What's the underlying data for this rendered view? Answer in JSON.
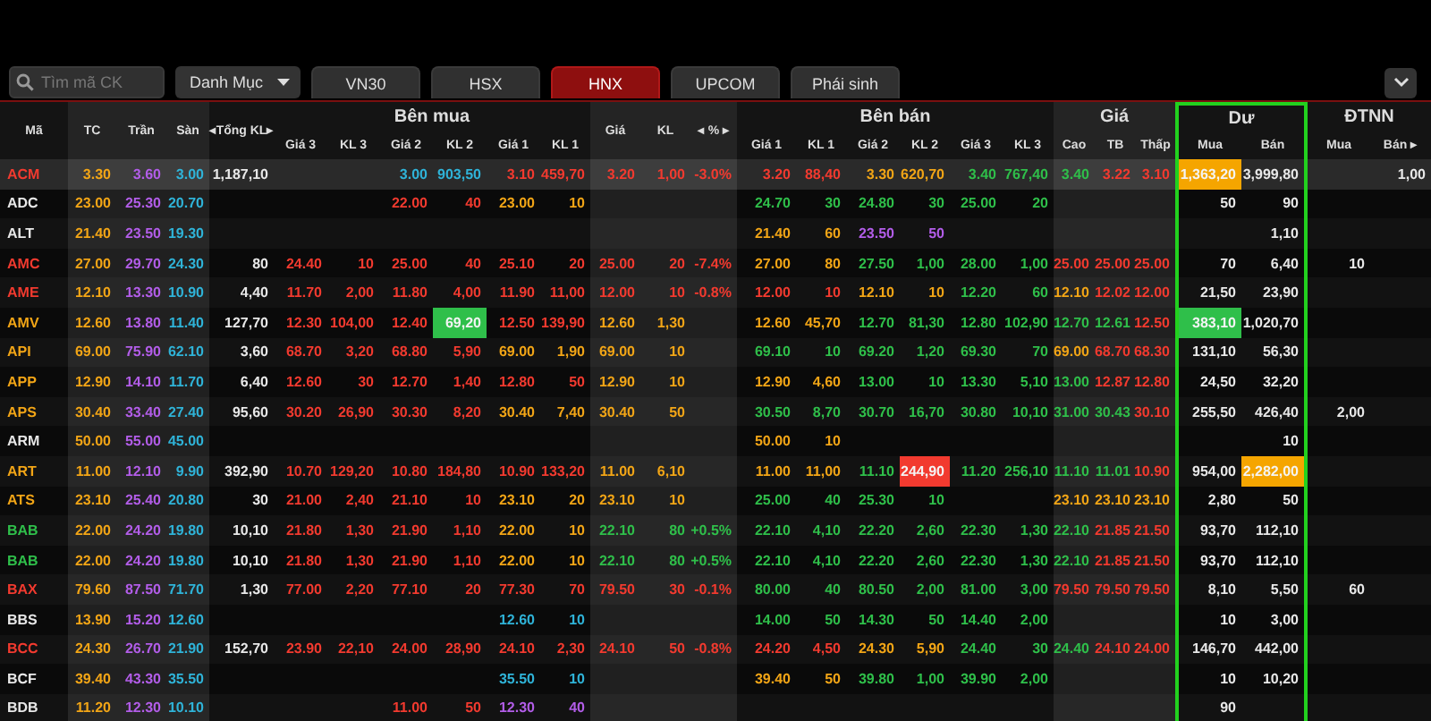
{
  "toolbar": {
    "search": {
      "placeholder": "Tìm mã CK"
    },
    "category_dropdown": {
      "label": "Danh Mục"
    },
    "tabs": [
      {
        "label": "VN30",
        "selected": false
      },
      {
        "label": "HSX",
        "selected": false
      },
      {
        "label": "HNX",
        "selected": true
      },
      {
        "label": "UPCOM",
        "selected": false
      },
      {
        "label": "Phái sinh",
        "selected": false
      }
    ]
  },
  "table": {
    "column_groups": [
      {
        "columns": [
          "Mã"
        ],
        "highlighted": false
      },
      {
        "columns": [
          "TC",
          "Trần",
          "Sàn"
        ],
        "highlighted": false
      },
      {
        "columns": [
          "◂Tổng KL▸"
        ],
        "highlighted": false
      },
      {
        "label": "Bên mua",
        "columns": [
          "Giá 3",
          "KL 3",
          "Giá 2",
          "KL 2",
          "Giá 1",
          "KL 1"
        ],
        "highlighted": false
      },
      {
        "columns": [
          "Giá",
          "KL",
          "◂ % ▸"
        ],
        "highlighted": false
      },
      {
        "label": "Bên bán",
        "columns": [
          "Giá 1",
          "KL 1",
          "Giá 2",
          "KL 2",
          "Giá 3",
          "KL 3"
        ],
        "highlighted": false
      },
      {
        "label": "Giá",
        "columns": [
          "Cao",
          "TB",
          "Thấp"
        ],
        "highlighted": false
      },
      {
        "label": "Dư",
        "columns": [
          "Mua",
          "Bán"
        ],
        "highlighted": true
      },
      {
        "label": "ĐTNN",
        "columns": [
          "Mua",
          "Bán ▸"
        ],
        "highlighted": false
      }
    ],
    "rows": [
      {
        "selected": true,
        "cells": [
          {
            "text": "ACM",
            "color": "#f23a2f"
          },
          {
            "text": "3.30",
            "color": "#f2a516"
          },
          {
            "text": "3.60",
            "color": "#b25de8"
          },
          {
            "text": "3.00",
            "color": "#2fb3d8"
          },
          {
            "text": "1,187,10",
            "color": "#e8e8e8"
          },
          null,
          null,
          {
            "text": "3.00",
            "color": "#2fb3d8"
          },
          {
            "text": "903,50",
            "color": "#2fb3d8"
          },
          {
            "text": "3.10",
            "color": "#f23a2f"
          },
          {
            "text": "459,70",
            "color": "#f23a2f"
          },
          {
            "text": "3.20",
            "color": "#f23a2f"
          },
          {
            "text": "1,00",
            "color": "#f23a2f"
          },
          {
            "text": "-3.0%",
            "color": "#f23a2f"
          },
          {
            "text": "3.20",
            "color": "#f23a2f"
          },
          {
            "text": "88,40",
            "color": "#f23a2f"
          },
          {
            "text": "3.30",
            "color": "#f2a516"
          },
          {
            "text": "620,70",
            "color": "#f2a516"
          },
          {
            "text": "3.40",
            "color": "#2fbf4a"
          },
          {
            "text": "767,40",
            "color": "#2fbf4a"
          },
          {
            "text": "3.40",
            "color": "#2fbf4a"
          },
          {
            "text": "3.22",
            "color": "#f23a2f"
          },
          {
            "text": "3.10",
            "color": "#f23a2f"
          },
          {
            "text": "1,363,20",
            "color": "#f5a500",
            "highlighted": true
          },
          {
            "text": "3,999,80",
            "color": "#e8e8e8"
          },
          null,
          {
            "text": "1,00",
            "color": "#e8e8e8"
          }
        ]
      },
      {
        "selected": false,
        "cells": [
          {
            "text": "ADC",
            "color": "#e8e8e8"
          },
          {
            "text": "23.00",
            "color": "#f2a516"
          },
          {
            "text": "25.30",
            "color": "#b25de8"
          },
          {
            "text": "20.70",
            "color": "#2fb3d8"
          },
          null,
          null,
          null,
          {
            "text": "22.00",
            "color": "#f23a2f"
          },
          {
            "text": "40",
            "color": "#f23a2f"
          },
          {
            "text": "23.00",
            "color": "#f2a516"
          },
          {
            "text": "10",
            "color": "#f2a516"
          },
          null,
          null,
          null,
          {
            "text": "24.70",
            "color": "#2fbf4a"
          },
          {
            "text": "30",
            "color": "#2fbf4a"
          },
          {
            "text": "24.80",
            "color": "#2fbf4a"
          },
          {
            "text": "30",
            "color": "#2fbf4a"
          },
          {
            "text": "25.00",
            "color": "#2fbf4a"
          },
          {
            "text": "20",
            "color": "#2fbf4a"
          },
          null,
          null,
          null,
          {
            "text": "50",
            "color": "#e8e8e8"
          },
          {
            "text": "90",
            "color": "#e8e8e8"
          },
          null,
          null
        ]
      },
      {
        "selected": false,
        "cells": [
          {
            "text": "ALT",
            "color": "#e8e8e8"
          },
          {
            "text": "21.40",
            "color": "#f2a516"
          },
          {
            "text": "23.50",
            "color": "#b25de8"
          },
          {
            "text": "19.30",
            "color": "#2fb3d8"
          },
          null,
          null,
          null,
          null,
          null,
          null,
          null,
          null,
          null,
          null,
          {
            "text": "21.40",
            "color": "#f2a516"
          },
          {
            "text": "60",
            "color": "#f2a516"
          },
          {
            "text": "23.50",
            "color": "#b25de8"
          },
          {
            "text": "50",
            "color": "#b25de8"
          },
          null,
          null,
          null,
          null,
          null,
          null,
          {
            "text": "1,10",
            "color": "#e8e8e8"
          },
          null,
          null
        ]
      },
      {
        "selected": false,
        "cells": [
          {
            "text": "AMC",
            "color": "#f23a2f"
          },
          {
            "text": "27.00",
            "color": "#f2a516"
          },
          {
            "text": "29.70",
            "color": "#b25de8"
          },
          {
            "text": "24.30",
            "color": "#2fb3d8"
          },
          {
            "text": "80",
            "color": "#e8e8e8"
          },
          {
            "text": "24.40",
            "color": "#f23a2f"
          },
          {
            "text": "10",
            "color": "#f23a2f"
          },
          {
            "text": "25.00",
            "color": "#f23a2f"
          },
          {
            "text": "40",
            "color": "#f23a2f"
          },
          {
            "text": "25.10",
            "color": "#f23a2f"
          },
          {
            "text": "20",
            "color": "#f23a2f"
          },
          {
            "text": "25.00",
            "color": "#f23a2f"
          },
          {
            "text": "20",
            "color": "#f23a2f"
          },
          {
            "text": "-7.4%",
            "color": "#f23a2f"
          },
          {
            "text": "27.00",
            "color": "#f2a516"
          },
          {
            "text": "80",
            "color": "#f2a516"
          },
          {
            "text": "27.50",
            "color": "#2fbf4a"
          },
          {
            "text": "1,00",
            "color": "#2fbf4a"
          },
          {
            "text": "28.00",
            "color": "#2fbf4a"
          },
          {
            "text": "1,00",
            "color": "#2fbf4a"
          },
          {
            "text": "25.00",
            "color": "#f23a2f"
          },
          {
            "text": "25.00",
            "color": "#f23a2f"
          },
          {
            "text": "25.00",
            "color": "#f23a2f"
          },
          {
            "text": "70",
            "color": "#e8e8e8"
          },
          {
            "text": "6,40",
            "color": "#e8e8e8"
          },
          {
            "text": "10",
            "color": "#e8e8e8"
          },
          null
        ]
      },
      {
        "selected": false,
        "cells": [
          {
            "text": "AME",
            "color": "#f23a2f"
          },
          {
            "text": "12.10",
            "color": "#f2a516"
          },
          {
            "text": "13.30",
            "color": "#b25de8"
          },
          {
            "text": "10.90",
            "color": "#2fb3d8"
          },
          {
            "text": "4,40",
            "color": "#e8e8e8"
          },
          {
            "text": "11.70",
            "color": "#f23a2f"
          },
          {
            "text": "2,00",
            "color": "#f23a2f"
          },
          {
            "text": "11.80",
            "color": "#f23a2f"
          },
          {
            "text": "4,00",
            "color": "#f23a2f"
          },
          {
            "text": "11.90",
            "color": "#f23a2f"
          },
          {
            "text": "11,00",
            "color": "#f23a2f"
          },
          {
            "text": "12.00",
            "color": "#f23a2f"
          },
          {
            "text": "10",
            "color": "#f23a2f"
          },
          {
            "text": "-0.8%",
            "color": "#f23a2f"
          },
          {
            "text": "12.00",
            "color": "#f23a2f"
          },
          {
            "text": "10",
            "color": "#f23a2f"
          },
          {
            "text": "12.10",
            "color": "#f2a516"
          },
          {
            "text": "10",
            "color": "#f2a516"
          },
          {
            "text": "12.20",
            "color": "#2fbf4a"
          },
          {
            "text": "60",
            "color": "#2fbf4a"
          },
          {
            "text": "12.10",
            "color": "#f2a516"
          },
          {
            "text": "12.02",
            "color": "#f23a2f"
          },
          {
            "text": "12.00",
            "color": "#f23a2f"
          },
          {
            "text": "21,50",
            "color": "#e8e8e8"
          },
          {
            "text": "23,90",
            "color": "#e8e8e8"
          },
          null,
          null
        ]
      },
      {
        "selected": false,
        "cells": [
          {
            "text": "AMV",
            "color": "#f2a516"
          },
          {
            "text": "12.60",
            "color": "#f2a516"
          },
          {
            "text": "13.80",
            "color": "#b25de8"
          },
          {
            "text": "11.40",
            "color": "#2fb3d8"
          },
          {
            "text": "127,70",
            "color": "#e8e8e8"
          },
          {
            "text": "12.30",
            "color": "#f23a2f"
          },
          {
            "text": "104,00",
            "color": "#f23a2f"
          },
          {
            "text": "12.40",
            "color": "#f23a2f"
          },
          {
            "text": "69,20",
            "color": "#2fbf4a",
            "highlighted": true
          },
          {
            "text": "12.50",
            "color": "#f23a2f"
          },
          {
            "text": "139,90",
            "color": "#f23a2f"
          },
          {
            "text": "12.60",
            "color": "#f2a516"
          },
          {
            "text": "1,30",
            "color": "#f2a516"
          },
          null,
          {
            "text": "12.60",
            "color": "#f2a516"
          },
          {
            "text": "45,70",
            "color": "#f2a516"
          },
          {
            "text": "12.70",
            "color": "#2fbf4a"
          },
          {
            "text": "81,30",
            "color": "#2fbf4a"
          },
          {
            "text": "12.80",
            "color": "#2fbf4a"
          },
          {
            "text": "102,90",
            "color": "#2fbf4a"
          },
          {
            "text": "12.70",
            "color": "#2fbf4a"
          },
          {
            "text": "12.61",
            "color": "#2fbf4a"
          },
          {
            "text": "12.50",
            "color": "#f23a2f"
          },
          {
            "text": "383,10",
            "color": "#2fbf4a",
            "highlighted": true
          },
          {
            "text": "1,020,70",
            "color": "#e8e8e8"
          },
          null,
          null
        ]
      },
      {
        "selected": false,
        "cells": [
          {
            "text": "API",
            "color": "#f2a516"
          },
          {
            "text": "69.00",
            "color": "#f2a516"
          },
          {
            "text": "75.90",
            "color": "#b25de8"
          },
          {
            "text": "62.10",
            "color": "#2fb3d8"
          },
          {
            "text": "3,60",
            "color": "#e8e8e8"
          },
          {
            "text": "68.70",
            "color": "#f23a2f"
          },
          {
            "text": "3,20",
            "color": "#f23a2f"
          },
          {
            "text": "68.80",
            "color": "#f23a2f"
          },
          {
            "text": "5,90",
            "color": "#f23a2f"
          },
          {
            "text": "69.00",
            "color": "#f2a516"
          },
          {
            "text": "1,90",
            "color": "#f2a516"
          },
          {
            "text": "69.00",
            "color": "#f2a516"
          },
          {
            "text": "10",
            "color": "#f2a516"
          },
          null,
          {
            "text": "69.10",
            "color": "#2fbf4a"
          },
          {
            "text": "10",
            "color": "#2fbf4a"
          },
          {
            "text": "69.20",
            "color": "#2fbf4a"
          },
          {
            "text": "1,20",
            "color": "#2fbf4a"
          },
          {
            "text": "69.30",
            "color": "#2fbf4a"
          },
          {
            "text": "70",
            "color": "#2fbf4a"
          },
          {
            "text": "69.00",
            "color": "#f2a516"
          },
          {
            "text": "68.70",
            "color": "#f23a2f"
          },
          {
            "text": "68.30",
            "color": "#f23a2f"
          },
          {
            "text": "131,10",
            "color": "#e8e8e8"
          },
          {
            "text": "56,30",
            "color": "#e8e8e8"
          },
          null,
          null
        ]
      },
      {
        "selected": false,
        "cells": [
          {
            "text": "APP",
            "color": "#f2a516"
          },
          {
            "text": "12.90",
            "color": "#f2a516"
          },
          {
            "text": "14.10",
            "color": "#b25de8"
          },
          {
            "text": "11.70",
            "color": "#2fb3d8"
          },
          {
            "text": "6,40",
            "color": "#e8e8e8"
          },
          {
            "text": "12.60",
            "color": "#f23a2f"
          },
          {
            "text": "30",
            "color": "#f23a2f"
          },
          {
            "text": "12.70",
            "color": "#f23a2f"
          },
          {
            "text": "1,40",
            "color": "#f23a2f"
          },
          {
            "text": "12.80",
            "color": "#f23a2f"
          },
          {
            "text": "50",
            "color": "#f23a2f"
          },
          {
            "text": "12.90",
            "color": "#f2a516"
          },
          {
            "text": "10",
            "color": "#f2a516"
          },
          null,
          {
            "text": "12.90",
            "color": "#f2a516"
          },
          {
            "text": "4,60",
            "color": "#f2a516"
          },
          {
            "text": "13.00",
            "color": "#2fbf4a"
          },
          {
            "text": "10",
            "color": "#2fbf4a"
          },
          {
            "text": "13.30",
            "color": "#2fbf4a"
          },
          {
            "text": "5,10",
            "color": "#2fbf4a"
          },
          {
            "text": "13.00",
            "color": "#2fbf4a"
          },
          {
            "text": "12.87",
            "color": "#f23a2f"
          },
          {
            "text": "12.80",
            "color": "#f23a2f"
          },
          {
            "text": "24,50",
            "color": "#e8e8e8"
          },
          {
            "text": "32,20",
            "color": "#e8e8e8"
          },
          null,
          null
        ]
      },
      {
        "selected": false,
        "cells": [
          {
            "text": "APS",
            "color": "#f2a516"
          },
          {
            "text": "30.40",
            "color": "#f2a516"
          },
          {
            "text": "33.40",
            "color": "#b25de8"
          },
          {
            "text": "27.40",
            "color": "#2fb3d8"
          },
          {
            "text": "95,60",
            "color": "#e8e8e8"
          },
          {
            "text": "30.20",
            "color": "#f23a2f"
          },
          {
            "text": "26,90",
            "color": "#f23a2f"
          },
          {
            "text": "30.30",
            "color": "#f23a2f"
          },
          {
            "text": "8,20",
            "color": "#f23a2f"
          },
          {
            "text": "30.40",
            "color": "#f2a516"
          },
          {
            "text": "7,40",
            "color": "#f2a516"
          },
          {
            "text": "30.40",
            "color": "#f2a516"
          },
          {
            "text": "50",
            "color": "#f2a516"
          },
          null,
          {
            "text": "30.50",
            "color": "#2fbf4a"
          },
          {
            "text": "8,70",
            "color": "#2fbf4a"
          },
          {
            "text": "30.70",
            "color": "#2fbf4a"
          },
          {
            "text": "16,70",
            "color": "#2fbf4a"
          },
          {
            "text": "30.80",
            "color": "#2fbf4a"
          },
          {
            "text": "10,10",
            "color": "#2fbf4a"
          },
          {
            "text": "31.00",
            "color": "#2fbf4a"
          },
          {
            "text": "30.43",
            "color": "#2fbf4a"
          },
          {
            "text": "30.10",
            "color": "#f23a2f"
          },
          {
            "text": "255,50",
            "color": "#e8e8e8"
          },
          {
            "text": "426,40",
            "color": "#e8e8e8"
          },
          {
            "text": "2,00",
            "color": "#e8e8e8"
          },
          null
        ]
      },
      {
        "selected": false,
        "cells": [
          {
            "text": "ARM",
            "color": "#e8e8e8"
          },
          {
            "text": "50.00",
            "color": "#f2a516"
          },
          {
            "text": "55.00",
            "color": "#b25de8"
          },
          {
            "text": "45.00",
            "color": "#2fb3d8"
          },
          null,
          null,
          null,
          null,
          null,
          null,
          null,
          null,
          null,
          null,
          {
            "text": "50.00",
            "color": "#f2a516"
          },
          {
            "text": "10",
            "color": "#f2a516"
          },
          null,
          null,
          null,
          null,
          null,
          null,
          null,
          null,
          {
            "text": "10",
            "color": "#e8e8e8"
          },
          null,
          null
        ]
      },
      {
        "selected": false,
        "cells": [
          {
            "text": "ART",
            "color": "#f2a516"
          },
          {
            "text": "11.00",
            "color": "#f2a516"
          },
          {
            "text": "12.10",
            "color": "#b25de8"
          },
          {
            "text": "9.90",
            "color": "#2fb3d8"
          },
          {
            "text": "392,90",
            "color": "#e8e8e8"
          },
          {
            "text": "10.70",
            "color": "#f23a2f"
          },
          {
            "text": "129,20",
            "color": "#f23a2f"
          },
          {
            "text": "10.80",
            "color": "#f23a2f"
          },
          {
            "text": "184,80",
            "color": "#f23a2f"
          },
          {
            "text": "10.90",
            "color": "#f23a2f"
          },
          {
            "text": "133,20",
            "color": "#f23a2f"
          },
          {
            "text": "11.00",
            "color": "#f2a516"
          },
          {
            "text": "6,10",
            "color": "#f2a516"
          },
          null,
          {
            "text": "11.00",
            "color": "#f2a516"
          },
          {
            "text": "11,00",
            "color": "#f2a516"
          },
          {
            "text": "11.10",
            "color": "#2fbf4a"
          },
          {
            "text": "244,90",
            "color": "#f23a2f",
            "highlighted": true
          },
          {
            "text": "11.20",
            "color": "#2fbf4a"
          },
          {
            "text": "256,10",
            "color": "#2fbf4a"
          },
          {
            "text": "11.10",
            "color": "#2fbf4a"
          },
          {
            "text": "11.01",
            "color": "#2fbf4a"
          },
          {
            "text": "10.90",
            "color": "#f23a2f"
          },
          {
            "text": "954,00",
            "color": "#e8e8e8"
          },
          {
            "text": "2,282,00",
            "color": "#f5a500",
            "highlighted": true
          },
          null,
          null
        ]
      },
      {
        "selected": false,
        "cells": [
          {
            "text": "ATS",
            "color": "#f2a516"
          },
          {
            "text": "23.10",
            "color": "#f2a516"
          },
          {
            "text": "25.40",
            "color": "#b25de8"
          },
          {
            "text": "20.80",
            "color": "#2fb3d8"
          },
          {
            "text": "30",
            "color": "#e8e8e8"
          },
          {
            "text": "21.00",
            "color": "#f23a2f"
          },
          {
            "text": "2,40",
            "color": "#f23a2f"
          },
          {
            "text": "21.10",
            "color": "#f23a2f"
          },
          {
            "text": "10",
            "color": "#f23a2f"
          },
          {
            "text": "23.10",
            "color": "#f2a516"
          },
          {
            "text": "20",
            "color": "#f2a516"
          },
          {
            "text": "23.10",
            "color": "#f2a516"
          },
          {
            "text": "10",
            "color": "#f2a516"
          },
          null,
          {
            "text": "25.00",
            "color": "#2fbf4a"
          },
          {
            "text": "40",
            "color": "#2fbf4a"
          },
          {
            "text": "25.30",
            "color": "#2fbf4a"
          },
          {
            "text": "10",
            "color": "#2fbf4a"
          },
          null,
          null,
          {
            "text": "23.10",
            "color": "#f2a516"
          },
          {
            "text": "23.10",
            "color": "#f2a516"
          },
          {
            "text": "23.10",
            "color": "#f2a516"
          },
          {
            "text": "2,80",
            "color": "#e8e8e8"
          },
          {
            "text": "50",
            "color": "#e8e8e8"
          },
          null,
          null
        ]
      },
      {
        "selected": false,
        "cells": [
          {
            "text": "BAB",
            "color": "#2fbf4a"
          },
          {
            "text": "22.00",
            "color": "#f2a516"
          },
          {
            "text": "24.20",
            "color": "#b25de8"
          },
          {
            "text": "19.80",
            "color": "#2fb3d8"
          },
          {
            "text": "10,10",
            "color": "#e8e8e8"
          },
          {
            "text": "21.80",
            "color": "#f23a2f"
          },
          {
            "text": "1,30",
            "color": "#f23a2f"
          },
          {
            "text": "21.90",
            "color": "#f23a2f"
          },
          {
            "text": "1,10",
            "color": "#f23a2f"
          },
          {
            "text": "22.00",
            "color": "#f2a516"
          },
          {
            "text": "10",
            "color": "#f2a516"
          },
          {
            "text": "22.10",
            "color": "#2fbf4a"
          },
          {
            "text": "80",
            "color": "#2fbf4a"
          },
          {
            "text": "+0.5%",
            "color": "#2fbf4a"
          },
          {
            "text": "22.10",
            "color": "#2fbf4a"
          },
          {
            "text": "4,10",
            "color": "#2fbf4a"
          },
          {
            "text": "22.20",
            "color": "#2fbf4a"
          },
          {
            "text": "2,60",
            "color": "#2fbf4a"
          },
          {
            "text": "22.30",
            "color": "#2fbf4a"
          },
          {
            "text": "1,30",
            "color": "#2fbf4a"
          },
          {
            "text": "22.10",
            "color": "#2fbf4a"
          },
          {
            "text": "21.85",
            "color": "#f23a2f"
          },
          {
            "text": "21.50",
            "color": "#f23a2f"
          },
          {
            "text": "93,70",
            "color": "#e8e8e8"
          },
          {
            "text": "112,10",
            "color": "#e8e8e8"
          },
          null,
          null
        ]
      },
      {
        "selected": false,
        "cells": [
          {
            "text": "BAB",
            "color": "#2fbf4a"
          },
          {
            "text": "22.00",
            "color": "#f2a516"
          },
          {
            "text": "24.20",
            "color": "#b25de8"
          },
          {
            "text": "19.80",
            "color": "#2fb3d8"
          },
          {
            "text": "10,10",
            "color": "#e8e8e8"
          },
          {
            "text": "21.80",
            "color": "#f23a2f"
          },
          {
            "text": "1,30",
            "color": "#f23a2f"
          },
          {
            "text": "21.90",
            "color": "#f23a2f"
          },
          {
            "text": "1,10",
            "color": "#f23a2f"
          },
          {
            "text": "22.00",
            "color": "#f2a516"
          },
          {
            "text": "10",
            "color": "#f2a516"
          },
          {
            "text": "22.10",
            "color": "#2fbf4a"
          },
          {
            "text": "80",
            "color": "#2fbf4a"
          },
          {
            "text": "+0.5%",
            "color": "#2fbf4a"
          },
          {
            "text": "22.10",
            "color": "#2fbf4a"
          },
          {
            "text": "4,10",
            "color": "#2fbf4a"
          },
          {
            "text": "22.20",
            "color": "#2fbf4a"
          },
          {
            "text": "2,60",
            "color": "#2fbf4a"
          },
          {
            "text": "22.30",
            "color": "#2fbf4a"
          },
          {
            "text": "1,30",
            "color": "#2fbf4a"
          },
          {
            "text": "22.10",
            "color": "#2fbf4a"
          },
          {
            "text": "21.85",
            "color": "#f23a2f"
          },
          {
            "text": "21.50",
            "color": "#f23a2f"
          },
          {
            "text": "93,70",
            "color": "#e8e8e8"
          },
          {
            "text": "112,10",
            "color": "#e8e8e8"
          },
          null,
          null
        ]
      },
      {
        "selected": false,
        "cells": [
          {
            "text": "BAX",
            "color": "#f23a2f"
          },
          {
            "text": "79.60",
            "color": "#f2a516"
          },
          {
            "text": "87.50",
            "color": "#b25de8"
          },
          {
            "text": "71.70",
            "color": "#2fb3d8"
          },
          {
            "text": "1,30",
            "color": "#e8e8e8"
          },
          {
            "text": "77.00",
            "color": "#f23a2f"
          },
          {
            "text": "2,20",
            "color": "#f23a2f"
          },
          {
            "text": "77.10",
            "color": "#f23a2f"
          },
          {
            "text": "20",
            "color": "#f23a2f"
          },
          {
            "text": "77.30",
            "color": "#f23a2f"
          },
          {
            "text": "70",
            "color": "#f23a2f"
          },
          {
            "text": "79.50",
            "color": "#f23a2f"
          },
          {
            "text": "30",
            "color": "#f23a2f"
          },
          {
            "text": "-0.1%",
            "color": "#f23a2f"
          },
          {
            "text": "80.00",
            "color": "#2fbf4a"
          },
          {
            "text": "40",
            "color": "#2fbf4a"
          },
          {
            "text": "80.50",
            "color": "#2fbf4a"
          },
          {
            "text": "2,00",
            "color": "#2fbf4a"
          },
          {
            "text": "81.00",
            "color": "#2fbf4a"
          },
          {
            "text": "3,00",
            "color": "#2fbf4a"
          },
          {
            "text": "79.50",
            "color": "#f23a2f"
          },
          {
            "text": "79.50",
            "color": "#f23a2f"
          },
          {
            "text": "79.50",
            "color": "#f23a2f"
          },
          {
            "text": "8,10",
            "color": "#e8e8e8"
          },
          {
            "text": "5,50",
            "color": "#e8e8e8"
          },
          {
            "text": "60",
            "color": "#e8e8e8"
          },
          null
        ]
      },
      {
        "selected": false,
        "cells": [
          {
            "text": "BBS",
            "color": "#e8e8e8"
          },
          {
            "text": "13.90",
            "color": "#f2a516"
          },
          {
            "text": "15.20",
            "color": "#b25de8"
          },
          {
            "text": "12.60",
            "color": "#2fb3d8"
          },
          null,
          null,
          null,
          null,
          null,
          {
            "text": "12.60",
            "color": "#2fb3d8"
          },
          {
            "text": "10",
            "color": "#2fb3d8"
          },
          null,
          null,
          null,
          {
            "text": "14.00",
            "color": "#2fbf4a"
          },
          {
            "text": "50",
            "color": "#2fbf4a"
          },
          {
            "text": "14.30",
            "color": "#2fbf4a"
          },
          {
            "text": "50",
            "color": "#2fbf4a"
          },
          {
            "text": "14.40",
            "color": "#2fbf4a"
          },
          {
            "text": "2,00",
            "color": "#2fbf4a"
          },
          null,
          null,
          null,
          {
            "text": "10",
            "color": "#e8e8e8"
          },
          {
            "text": "3,00",
            "color": "#e8e8e8"
          },
          null,
          null
        ]
      },
      {
        "selected": false,
        "cells": [
          {
            "text": "BCC",
            "color": "#f23a2f"
          },
          {
            "text": "24.30",
            "color": "#f2a516"
          },
          {
            "text": "26.70",
            "color": "#b25de8"
          },
          {
            "text": "21.90",
            "color": "#2fb3d8"
          },
          {
            "text": "152,70",
            "color": "#e8e8e8"
          },
          {
            "text": "23.90",
            "color": "#f23a2f"
          },
          {
            "text": "22,10",
            "color": "#f23a2f"
          },
          {
            "text": "24.00",
            "color": "#f23a2f"
          },
          {
            "text": "28,90",
            "color": "#f23a2f"
          },
          {
            "text": "24.10",
            "color": "#f23a2f"
          },
          {
            "text": "2,30",
            "color": "#f23a2f"
          },
          {
            "text": "24.10",
            "color": "#f23a2f"
          },
          {
            "text": "50",
            "color": "#f23a2f"
          },
          {
            "text": "-0.8%",
            "color": "#f23a2f"
          },
          {
            "text": "24.20",
            "color": "#f23a2f"
          },
          {
            "text": "4,50",
            "color": "#f23a2f"
          },
          {
            "text": "24.30",
            "color": "#f2a516"
          },
          {
            "text": "5,90",
            "color": "#f2a516"
          },
          {
            "text": "24.40",
            "color": "#2fbf4a"
          },
          {
            "text": "30",
            "color": "#2fbf4a"
          },
          {
            "text": "24.40",
            "color": "#2fbf4a"
          },
          {
            "text": "24.10",
            "color": "#f23a2f"
          },
          {
            "text": "24.00",
            "color": "#f23a2f"
          },
          {
            "text": "146,70",
            "color": "#e8e8e8"
          },
          {
            "text": "442,00",
            "color": "#e8e8e8"
          },
          null,
          null
        ]
      },
      {
        "selected": false,
        "cells": [
          {
            "text": "BCF",
            "color": "#e8e8e8"
          },
          {
            "text": "39.40",
            "color": "#f2a516"
          },
          {
            "text": "43.30",
            "color": "#b25de8"
          },
          {
            "text": "35.50",
            "color": "#2fb3d8"
          },
          null,
          null,
          null,
          null,
          null,
          {
            "text": "35.50",
            "color": "#2fb3d8"
          },
          {
            "text": "10",
            "color": "#2fb3d8"
          },
          null,
          null,
          null,
          {
            "text": "39.40",
            "color": "#f2a516"
          },
          {
            "text": "50",
            "color": "#f2a516"
          },
          {
            "text": "39.80",
            "color": "#2fbf4a"
          },
          {
            "text": "1,00",
            "color": "#2fbf4a"
          },
          {
            "text": "39.90",
            "color": "#2fbf4a"
          },
          {
            "text": "2,00",
            "color": "#2fbf4a"
          },
          null,
          null,
          null,
          {
            "text": "10",
            "color": "#e8e8e8"
          },
          {
            "text": "10,20",
            "color": "#e8e8e8"
          },
          null,
          null
        ]
      },
      {
        "selected": false,
        "cells": [
          {
            "text": "BDB",
            "color": "#e8e8e8"
          },
          {
            "text": "11.20",
            "color": "#f2a516"
          },
          {
            "text": "12.30",
            "color": "#b25de8"
          },
          {
            "text": "10.10",
            "color": "#2fb3d8"
          },
          null,
          null,
          null,
          {
            "text": "11.00",
            "color": "#f23a2f"
          },
          {
            "text": "50",
            "color": "#f23a2f"
          },
          {
            "text": "12.30",
            "color": "#b25de8"
          },
          {
            "text": "40",
            "color": "#b25de8"
          },
          null,
          null,
          null,
          null,
          null,
          null,
          null,
          null,
          null,
          null,
          null,
          null,
          {
            "text": "90",
            "color": "#e8e8e8"
          },
          null,
          null,
          null
        ]
      }
    ]
  }
}
